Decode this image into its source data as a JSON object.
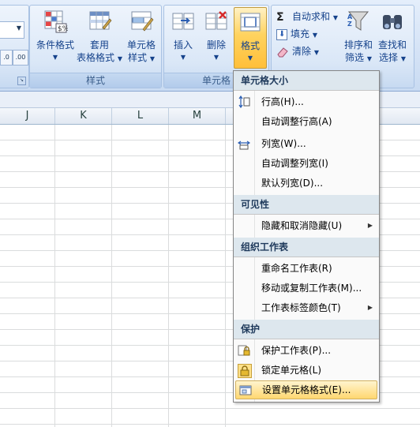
{
  "ribbon": {
    "styles_group": {
      "label": "样式",
      "conditional_format": [
        "条件格式",
        ""
      ],
      "table_format": [
        "套用",
        "表格格式"
      ],
      "cell_style": [
        "单元格",
        "样式"
      ]
    },
    "cells_group": {
      "label": "单元格",
      "insert": "插入",
      "delete": "删除",
      "format": "格式"
    },
    "editing_group": {
      "autosum": "自动求和",
      "fill": "填充",
      "clear": "清除",
      "sort": [
        "排序和",
        "筛选"
      ],
      "find": [
        "查找和",
        "选择"
      ]
    },
    "decimal_buttons": [
      ".0",
      ".00"
    ]
  },
  "columns": [
    "J",
    "K",
    "L",
    "M"
  ],
  "menu": {
    "sections": [
      {
        "header": "单元格大小",
        "items": [
          {
            "label": "行高(H)...",
            "icon": "row-height-icon"
          },
          {
            "label": "自动调整行高(A)",
            "icon": ""
          },
          {
            "label": "列宽(W)...",
            "icon": "column-width-icon"
          },
          {
            "label": "自动调整列宽(I)",
            "icon": ""
          },
          {
            "label": "默认列宽(D)...",
            "icon": ""
          }
        ]
      },
      {
        "header": "可见性",
        "items": [
          {
            "label": "隐藏和取消隐藏(U)",
            "icon": "",
            "submenu": true
          }
        ]
      },
      {
        "header": "组织工作表",
        "items": [
          {
            "label": "重命名工作表(R)",
            "icon": ""
          },
          {
            "label": "移动或复制工作表(M)...",
            "icon": ""
          },
          {
            "label": "工作表标签颜色(T)",
            "icon": "",
            "submenu": true
          }
        ]
      },
      {
        "header": "保护",
        "items": [
          {
            "label": "保护工作表(P)...",
            "icon": "protect-sheet-icon"
          },
          {
            "label": "锁定单元格(L)",
            "icon": "lock-icon"
          },
          {
            "label": "设置单元格格式(E)...",
            "icon": "format-cells-icon",
            "highlighted": true
          }
        ]
      }
    ]
  },
  "colors": {
    "ribbon_bg": "#d5e3f6",
    "highlight": "#ffd770",
    "menu_header": "#dde7ee"
  }
}
